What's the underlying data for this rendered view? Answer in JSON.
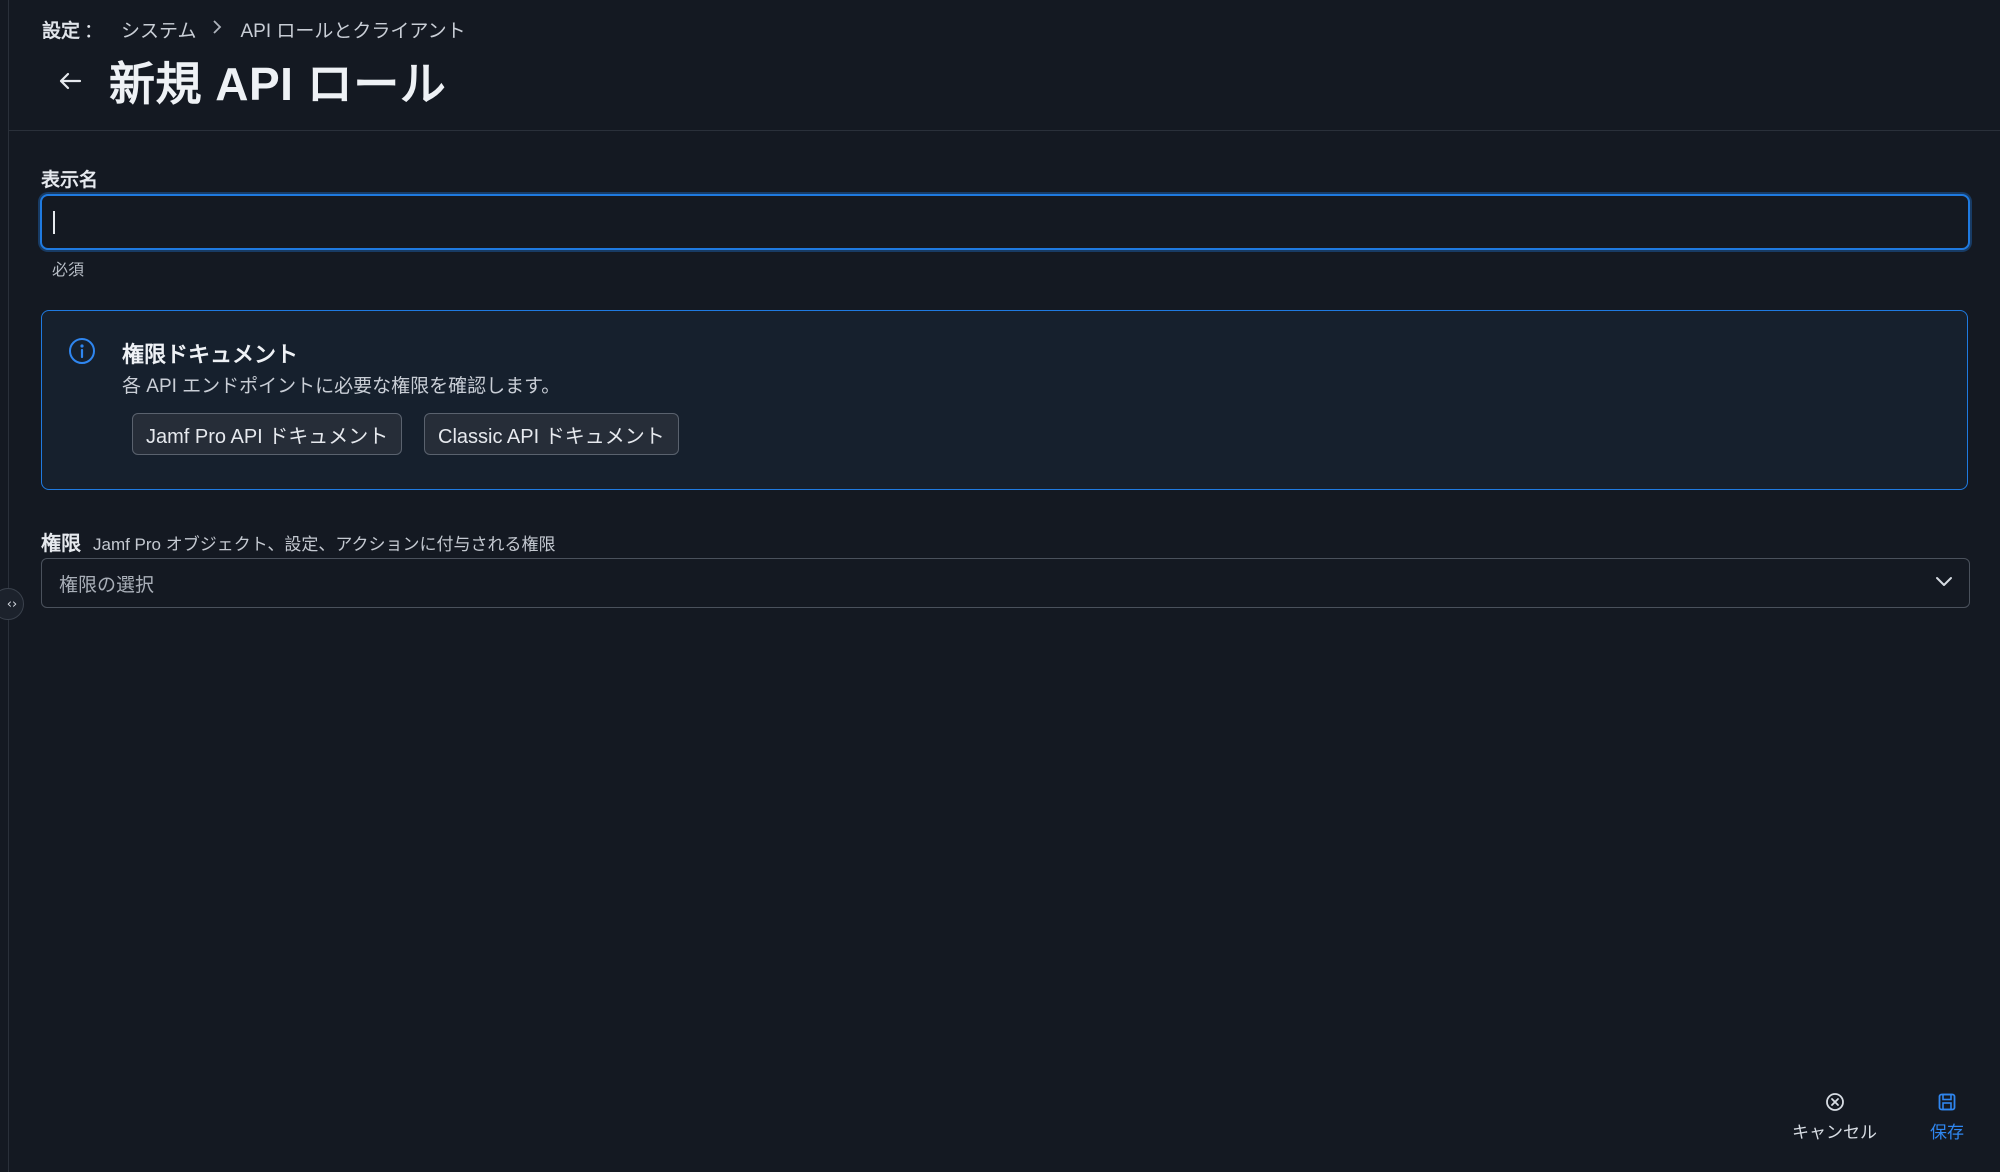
{
  "breadcrumb": {
    "root": "設定",
    "colon": "：",
    "items": [
      "システム",
      "API ロールとクライアント"
    ]
  },
  "page": {
    "title": "新規 API ロール"
  },
  "display_name": {
    "label": "表示名",
    "value": "",
    "helper": "必須"
  },
  "info": {
    "title": "権限ドキュメント",
    "description": "各 API エンドポイントに必要な権限を確認します。",
    "buttons": [
      "Jamf Pro API ドキュメント",
      "Classic API ドキュメント"
    ]
  },
  "permissions": {
    "label": "権限",
    "hint": "Jamf Pro オブジェクト、設定、アクションに付与される権限",
    "placeholder": "権限の選択"
  },
  "actions": {
    "cancel": "キャンセル",
    "save": "保存"
  },
  "colors": {
    "background": "#141922",
    "accent": "#1f7ae0",
    "save": "#2f86f0"
  },
  "icons": [
    "back-arrow-icon",
    "chevron-right-icon",
    "info-icon",
    "chevron-down-icon",
    "cancel-circle-icon",
    "save-disk-icon",
    "collapse-expand-icon"
  ]
}
